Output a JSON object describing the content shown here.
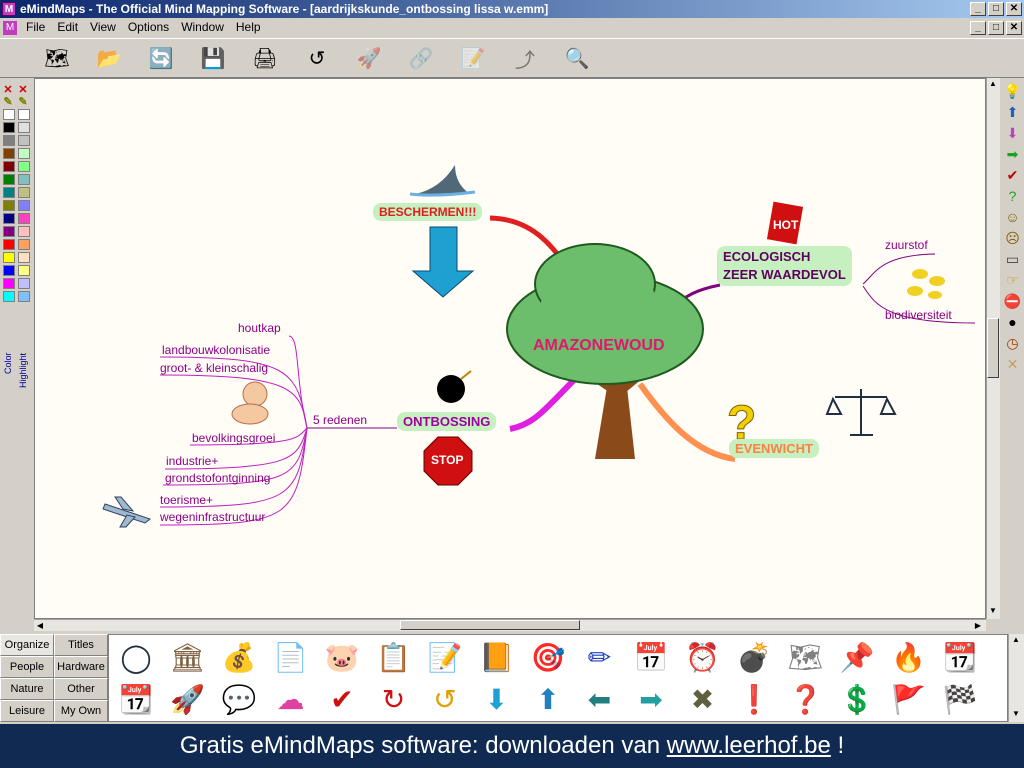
{
  "window": {
    "title": "eMindMaps - The Official  Mind Mapping Software - [aardrijkskunde_ontbossing lissa w.emm]",
    "app_icon_letter": "M",
    "controls": [
      "_",
      "□",
      "✕"
    ]
  },
  "menubar": {
    "items": [
      "File",
      "Edit",
      "View",
      "Options",
      "Window",
      "Help"
    ]
  },
  "toolbar": {
    "icons": [
      {
        "name": "new-map-icon",
        "glyph": "🗺",
        "enabled": true
      },
      {
        "name": "open-map-icon",
        "glyph": "📂",
        "enabled": true
      },
      {
        "name": "import-icon",
        "glyph": "🔄",
        "enabled": true
      },
      {
        "name": "save-icon",
        "glyph": "💾",
        "enabled": true
      },
      {
        "name": "print-icon",
        "glyph": "🖨",
        "enabled": true
      },
      {
        "name": "undo-icon",
        "glyph": "↺",
        "enabled": true
      },
      {
        "name": "rocket-icon",
        "glyph": "🚀",
        "enabled": false
      },
      {
        "name": "link-icon",
        "glyph": "🔗",
        "enabled": false
      },
      {
        "name": "note-icon",
        "glyph": "📝",
        "enabled": false
      },
      {
        "name": "branch-icon",
        "glyph": "⤴",
        "enabled": false
      },
      {
        "name": "zoom-icon",
        "glyph": "🔍",
        "enabled": true
      }
    ]
  },
  "palette": {
    "color_label": "Color",
    "highlight_label": "Highlight",
    "color_swatches": [
      "#ffffff",
      "#000000",
      "#808080",
      "#804000",
      "#800000",
      "#008000",
      "#008080",
      "#808000",
      "#000080",
      "#800080",
      "#ff0000",
      "#ffff00",
      "#0000ff",
      "#ff00ff",
      "#00ffff"
    ],
    "highlight_swatches": [
      "#ffffff",
      "#e0e0e0",
      "#c0c0c0",
      "#c0ffc0",
      "#80ff80",
      "#80c0c0",
      "#c0c080",
      "#8080ff",
      "#ff40c0",
      "#ffc0c0",
      "#ffa060",
      "#ffe0c0",
      "#ffff80",
      "#c0c0ff",
      "#80c0ff"
    ]
  },
  "mindmap": {
    "center": "AMAZONEWOUD",
    "topics": {
      "beschermen": "BESCHERMEN!!!",
      "ecologisch_line1": "ECOLOGISCH",
      "ecologisch_line2": "ZEER WAARDEVOL",
      "ontbossing": "ONTBOSSING",
      "evenwicht": "EVENWICHT"
    },
    "subtopics": {
      "zuurstof": "zuurstof",
      "biodiversiteit": "biodiversiteit",
      "redenen": "5 redenen",
      "houtkap": "houtkap",
      "landbouw": "landbouwkolonisatie",
      "grootklein": "groot- & kleinschalig",
      "bevolking": "bevolkingsgroei",
      "industrie": "industrie+",
      "grondstof": "grondstofontginning",
      "toerisme": "toerisme+",
      "wegen": "wegeninfrastructuur"
    },
    "stop_sign": "STOP",
    "hot_badge": "HOT"
  },
  "category_tabs": [
    "Organize",
    "Titles",
    "People",
    "Hardware",
    "Nature",
    "Other",
    "Leisure",
    "My Own"
  ],
  "gallery": {
    "row1": [
      "◯",
      "🏛",
      "💰",
      "📄",
      "🐷",
      "📋",
      "📝",
      "📙",
      "🎯",
      "✏",
      "📅",
      "⏰",
      "💣",
      "🗺",
      "📌",
      "🔥",
      "📆"
    ],
    "row2": [
      "📆",
      "🚀",
      "💬",
      "☁",
      "✔",
      "↻",
      "↺",
      "⬇",
      "⬆",
      "⬅",
      "➡",
      "✖",
      "❗",
      "❓",
      "💲",
      "🚩",
      "🏁"
    ]
  },
  "footer": {
    "text": "Gratis eMindMaps software: downloaden van ",
    "link": "www.leerhof.be",
    "tail": " !"
  }
}
